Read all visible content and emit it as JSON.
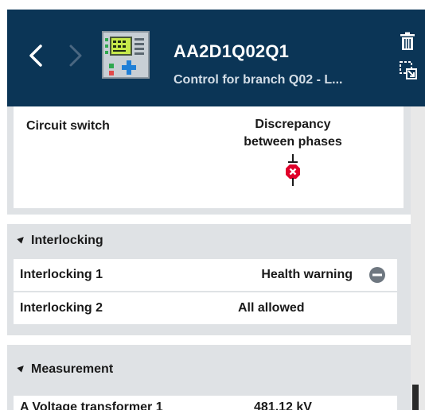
{
  "header": {
    "title": "AA2D1Q02Q1",
    "subtitle": "Control for branch Q02 - L...",
    "back_icon": "chevron-left-icon",
    "forward_icon": "chevron-right-icon",
    "device_icon": "ied-device-icon",
    "delete_icon": "trash-icon",
    "dock_icon": "undock-window-icon",
    "background_color": "#0b3556"
  },
  "circuit_switch": {
    "label": "Circuit switch",
    "state": "Discrepancy between phases",
    "icon": "switch-error-icon",
    "icon_color": "#e0002a"
  },
  "interlocking": {
    "title": "Interlocking",
    "rows": [
      {
        "label": "Interlocking 1",
        "value": "Health warning",
        "icon": "minus-circle-icon"
      },
      {
        "label": "Interlocking 2",
        "value": "All allowed"
      }
    ]
  },
  "measurement": {
    "title": "Measurement",
    "rows": [
      {
        "label": "A Voltage transformer 1",
        "value": "481.12 kV"
      }
    ]
  }
}
